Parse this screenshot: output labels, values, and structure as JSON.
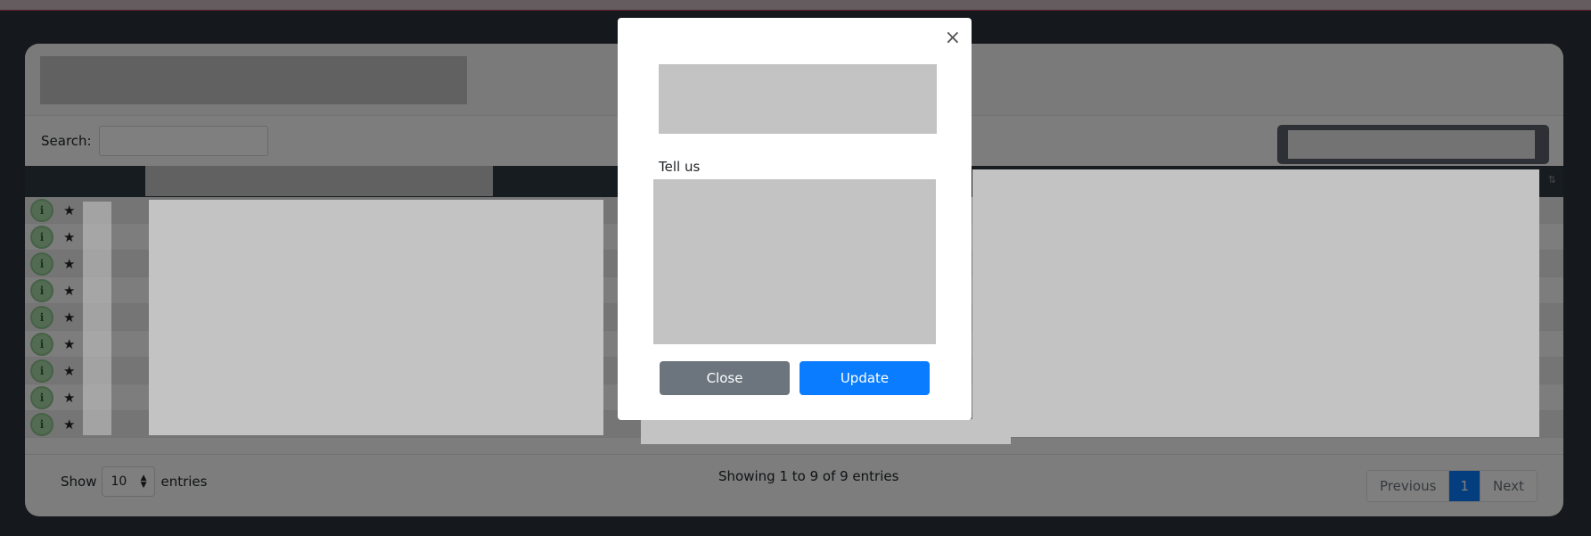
{
  "search": {
    "label": "Search:"
  },
  "table": {
    "rows": [
      {
        "info_icon": "i",
        "star_icon": "★"
      },
      {
        "info_icon": "i",
        "star_icon": "★"
      },
      {
        "info_icon": "i",
        "star_icon": "★"
      },
      {
        "info_icon": "i",
        "star_icon": "★"
      },
      {
        "info_icon": "i",
        "star_icon": "★"
      },
      {
        "info_icon": "i",
        "star_icon": "★"
      },
      {
        "info_icon": "i",
        "star_icon": "★"
      },
      {
        "info_icon": "i",
        "star_icon": "★"
      },
      {
        "info_icon": "i",
        "star_icon": "★"
      }
    ],
    "sort_icon": "⇅"
  },
  "footer": {
    "show_label": "Show",
    "entries_label": "entries",
    "page_length": "10",
    "info": "Showing 1 to 9 of 9 entries",
    "pagination": {
      "previous": "Previous",
      "current": "1",
      "next": "Next"
    }
  },
  "modal": {
    "close_icon": "×",
    "field_label": "Tell us",
    "close_button": "Close",
    "update_button": "Update"
  },
  "colors": {
    "primary": "#0a7cff",
    "secondary": "#6c757d",
    "info_button": "#a6d6a6"
  }
}
